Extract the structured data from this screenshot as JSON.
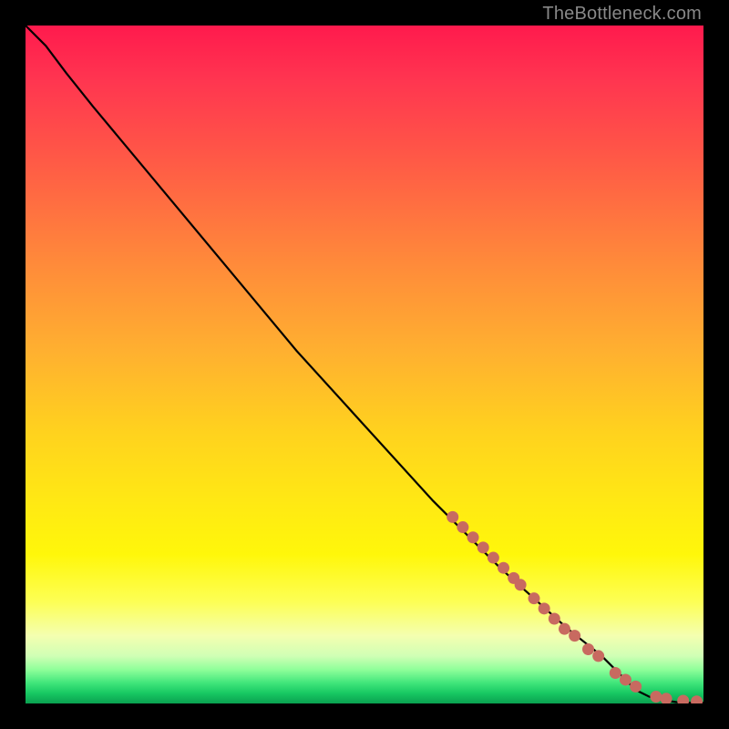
{
  "watermark": "TheBottleneck.com",
  "colors": {
    "curve": "#000000",
    "dots": "#c86a60",
    "frame_bg": "#000000"
  },
  "chart_data": {
    "type": "line",
    "title": "",
    "xlabel": "",
    "ylabel": "",
    "xlim": [
      0,
      100
    ],
    "ylim": [
      0,
      100
    ],
    "grid": false,
    "series": [
      {
        "name": "bottleneck-curve",
        "x": [
          0,
          3,
          6,
          10,
          15,
          20,
          30,
          40,
          50,
          60,
          70,
          80,
          85,
          88,
          90,
          92,
          94,
          96,
          98,
          100
        ],
        "y": [
          100,
          97,
          93,
          88,
          82,
          76,
          64,
          52,
          41,
          30,
          20,
          11,
          7,
          4,
          2,
          1,
          0.5,
          0.2,
          0.1,
          0.1
        ]
      }
    ],
    "highlight_dots": {
      "name": "highlighted-range",
      "x": [
        63,
        64.5,
        66,
        67.5,
        69,
        70.5,
        72,
        73,
        75,
        76.5,
        78,
        79.5,
        81,
        83,
        84.5,
        87,
        88.5,
        90,
        93,
        94.5,
        97,
        99
      ],
      "y": [
        27.5,
        26,
        24.5,
        23,
        21.5,
        20,
        18.5,
        17.5,
        15.5,
        14,
        12.5,
        11,
        10,
        8,
        7,
        4.5,
        3.5,
        2.5,
        1,
        0.7,
        0.4,
        0.3
      ]
    }
  }
}
